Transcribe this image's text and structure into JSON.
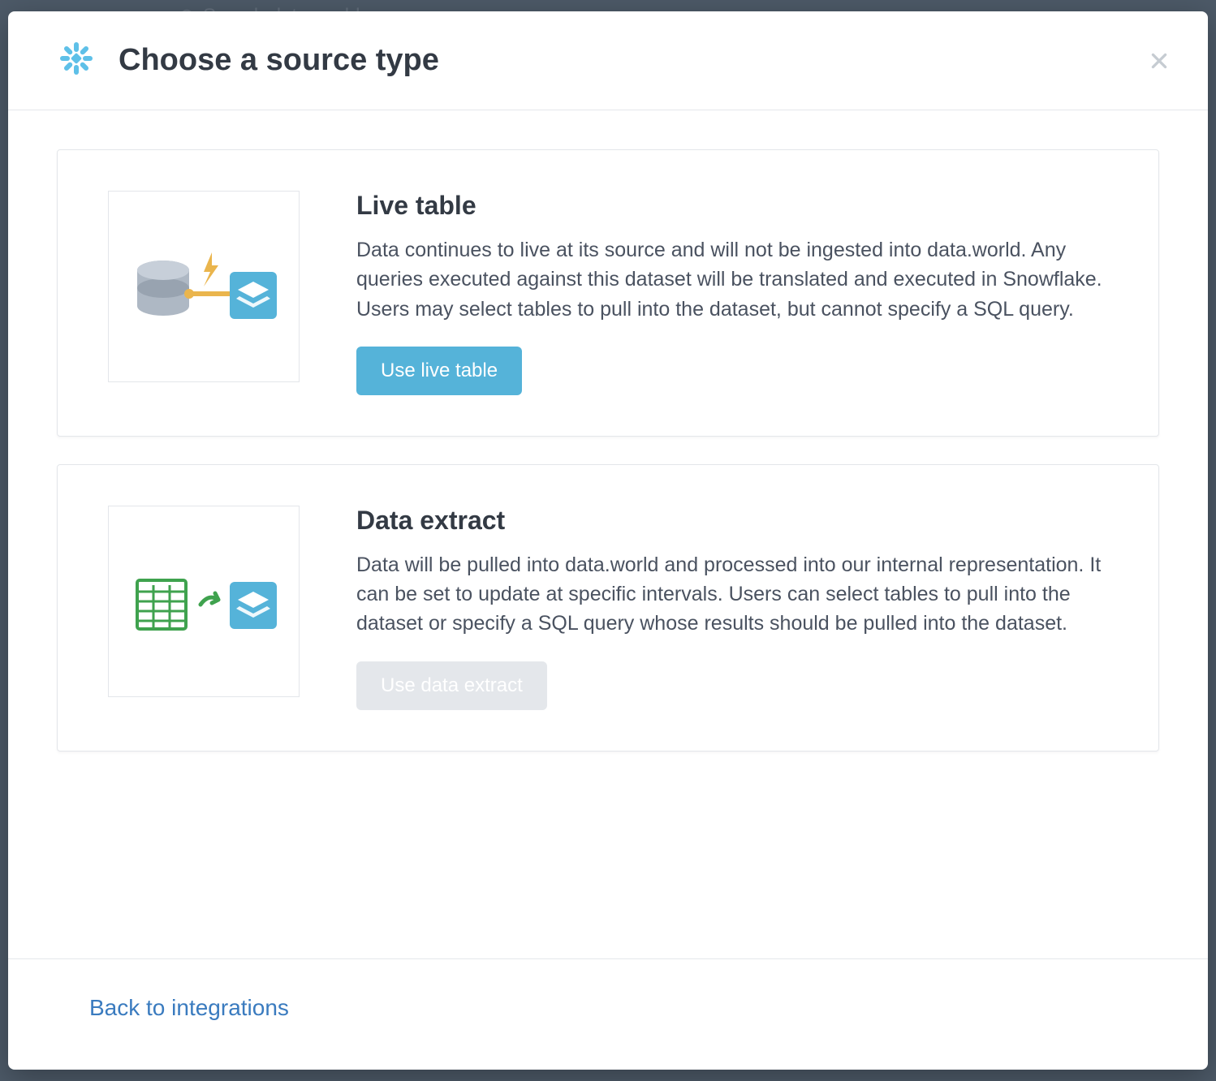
{
  "background": {
    "search_placeholder": "Search data.world"
  },
  "modal": {
    "title": "Choose a source type",
    "options": [
      {
        "title": "Live table",
        "description": "Data continues to live at its source and will not be ingested into data.world. Any queries executed against this dataset will be translated and executed in Snowflake. Users may select tables to pull into the dataset, but cannot specify a SQL query.",
        "button_label": "Use live table",
        "button_enabled": true
      },
      {
        "title": "Data extract",
        "description": "Data will be pulled into data.world and processed into our internal representation. It can be set to update at specific intervals. Users can select tables to pull into the dataset or specify a SQL query whose results should be pulled into the dataset.",
        "button_label": "Use data extract",
        "button_enabled": false
      }
    ],
    "footer": {
      "back_link_label": "Back to integrations"
    }
  }
}
